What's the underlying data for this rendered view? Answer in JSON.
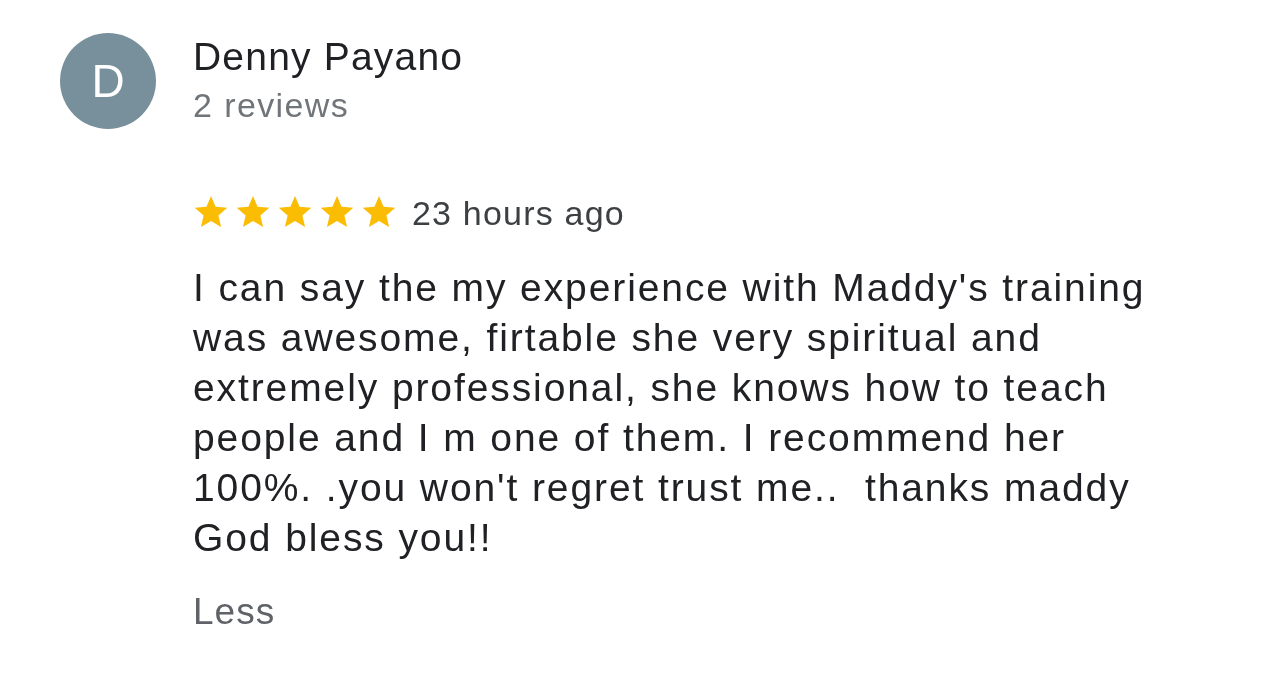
{
  "reviewer": {
    "avatar_letter": "D",
    "name": "Denny Payano",
    "reviews": "2 reviews"
  },
  "review": {
    "stars": 5,
    "time": "23 hours ago",
    "text": "I can say the my experience with Maddy's training was awesome, firtable she very spiritual and extremely professional, she knows how to teach people and I m one of them. I recommend her 100%. .you won't regret trust me..  thanks maddy God bless you!!",
    "toggle": "Less"
  }
}
